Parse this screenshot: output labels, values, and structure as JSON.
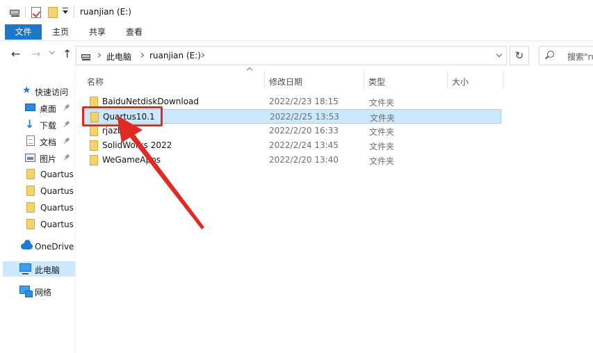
{
  "window": {
    "title": "ruanjian (E:)"
  },
  "ribbon": {
    "tabs": [
      {
        "label": "文件"
      },
      {
        "label": "主页"
      },
      {
        "label": "共享"
      },
      {
        "label": "查看"
      }
    ]
  },
  "address": {
    "crumbs": [
      {
        "label": "此电脑"
      },
      {
        "label": "ruanjian (E:)"
      }
    ]
  },
  "search": {
    "placeholder": "搜索\"ru"
  },
  "sidebar": {
    "items": [
      {
        "label": "快速访问",
        "icon": "star-icon"
      },
      {
        "label": "桌面",
        "icon": "desktop-icon",
        "pinned": true
      },
      {
        "label": "下载",
        "icon": "download-icon",
        "pinned": true
      },
      {
        "label": "文档",
        "icon": "document-icon",
        "pinned": true
      },
      {
        "label": "图片",
        "icon": "picture-icon",
        "pinned": true
      },
      {
        "label": "Quartus",
        "icon": "folder-icon"
      },
      {
        "label": "Quartus",
        "icon": "folder-icon"
      },
      {
        "label": "Quartus",
        "icon": "folder-icon"
      },
      {
        "label": "Quartus",
        "icon": "folder-icon"
      },
      {
        "label": "OneDrive",
        "icon": "onedrive-icon"
      },
      {
        "label": "此电脑",
        "icon": "computer-icon",
        "selected": true
      },
      {
        "label": "网络",
        "icon": "network-icon"
      }
    ]
  },
  "columns": {
    "name": "名称",
    "date": "修改日期",
    "type": "类型",
    "size": "大小"
  },
  "files": [
    {
      "name": "BaiduNetdiskDownload",
      "date": "2022/2/23 18:15",
      "type": "文件夹"
    },
    {
      "name": "Quartus10.1",
      "date": "2022/2/25 13:53",
      "type": "文件夹",
      "selected": true
    },
    {
      "name": "rjazb",
      "date": "2022/2/20 16:33",
      "type": "文件夹"
    },
    {
      "name": "SolidWorks 2022",
      "date": "2022/2/24 13:45",
      "type": "文件夹"
    },
    {
      "name": "WeGameApps",
      "date": "2022/2/20 13:40",
      "type": "文件夹"
    }
  ],
  "colors": {
    "accent": "#1979ca",
    "selection": "#cce8ff",
    "annotation": "#e02a24"
  }
}
